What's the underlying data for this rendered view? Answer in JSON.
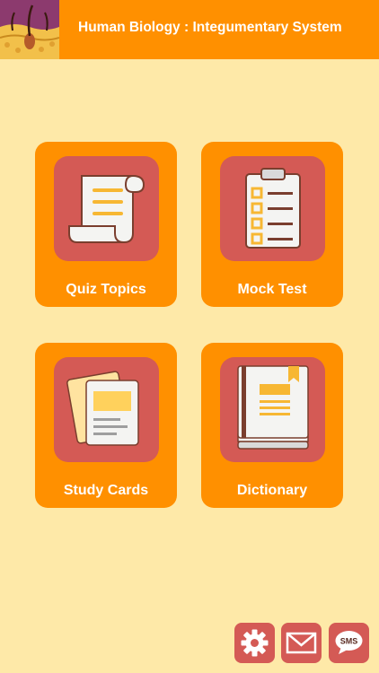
{
  "header": {
    "title": "Human Biology : Integumentary System",
    "logo_icon": "skin-hair-follicle-icon"
  },
  "menu": [
    {
      "label": "Quiz Topics",
      "icon": "scroll-document-icon"
    },
    {
      "label": "Mock Test",
      "icon": "clipboard-checklist-icon"
    },
    {
      "label": "Study Cards",
      "icon": "cards-icon"
    },
    {
      "label": "Dictionary",
      "icon": "book-icon"
    }
  ],
  "footer": {
    "settings_icon": "gear-icon",
    "mail_icon": "mail-icon",
    "sms_label": "SMS"
  },
  "colors": {
    "background": "#FEE9A8",
    "accent": "#FF9000",
    "icon_tile": "#D45A55",
    "logo": "#8C3A6E"
  }
}
